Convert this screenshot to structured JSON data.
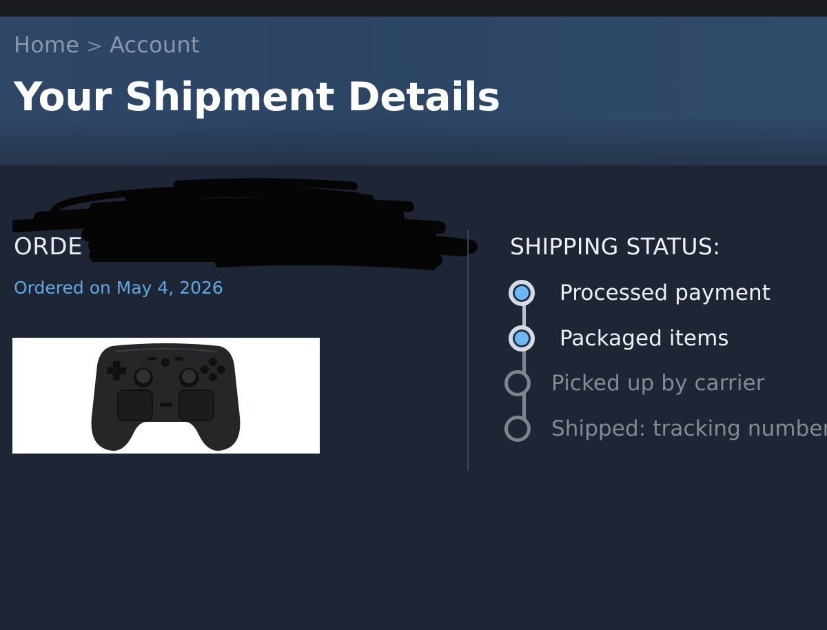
{
  "breadcrumb": {
    "home": "Home",
    "separator": ">",
    "account": "Account"
  },
  "page": {
    "title": "Your Shipment Details"
  },
  "order": {
    "label_visible": "ORDE",
    "ordered_on": "Ordered on May 4, 2026",
    "product_image_alt": "game controller"
  },
  "shipping_status": {
    "heading": "SHIPPING STATUS:",
    "steps": [
      {
        "label": "Processed payment",
        "state": "complete"
      },
      {
        "label": "Packaged items",
        "state": "complete"
      },
      {
        "label": "Picked up by carrier",
        "state": "pending"
      },
      {
        "label": "Shipped: tracking number",
        "state": "pending"
      }
    ]
  },
  "colors": {
    "background": "#1e2535",
    "header_background": "#2f4767",
    "accent_link": "#63a7e2",
    "step_complete_fill": "#6cb8f5",
    "step_pending": "#7d848d"
  }
}
